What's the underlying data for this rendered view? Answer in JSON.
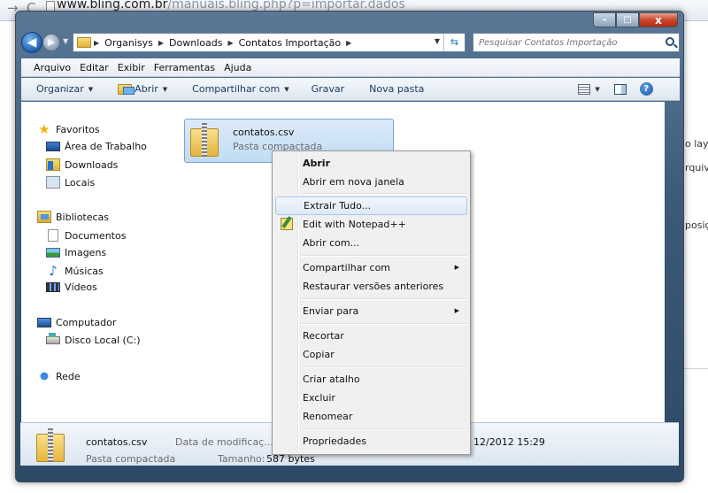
{
  "browser": {
    "url_domain": "www.bling.com.br",
    "url_path": "/manuais.bling.php?p=importar.dados"
  },
  "background_text": {
    "line1": "o lay",
    "line2": "rquivo",
    "line3": "posiç"
  },
  "window": {
    "caption_buttons": {
      "minimize": "–",
      "maximize": "□",
      "close": "x"
    }
  },
  "address_bar": {
    "breadcrumbs": [
      "Organisys",
      "Downloads",
      "Contatos Importação"
    ],
    "search_placeholder": "Pesquisar Contatos Importação"
  },
  "menubar": [
    "Arquivo",
    "Editar",
    "Exibir",
    "Ferramentas",
    "Ajuda"
  ],
  "toolbar": {
    "organize": "Organizar",
    "open": "Abrir",
    "share": "Compartilhar com",
    "burn": "Gravar",
    "new_folder": "Nova pasta",
    "help": "?"
  },
  "navpane": {
    "favorites": "Favoritos",
    "desktop": "Área de Trabalho",
    "downloads": "Downloads",
    "places": "Locais",
    "libraries": "Bibliotecas",
    "documents": "Documentos",
    "images": "Imagens",
    "music": "Músicas",
    "videos": "Vídeos",
    "computer": "Computador",
    "local_disk": "Disco Local (C:)",
    "network": "Rede"
  },
  "file": {
    "name": "contatos.csv",
    "type": "Pasta compactada"
  },
  "details": {
    "name": "contatos.csv",
    "type": "Pasta compactada",
    "modified_label": "Data de modificaç... 1",
    "modified_value": "12/2012 15:29",
    "size_label": "Tamanho:",
    "size_value": "587 bytes"
  },
  "context_menu": {
    "open": "Abrir",
    "open_new_window": "Abrir em nova janela",
    "extract_all": "Extrair Tudo...",
    "edit_notepad": "Edit with Notepad++",
    "open_with": "Abrir com...",
    "share_with": "Compartilhar com",
    "restore_versions": "Restaurar versões anteriores",
    "send_to": "Enviar para",
    "cut": "Recortar",
    "copy": "Copiar",
    "create_shortcut": "Criar atalho",
    "delete": "Excluir",
    "rename": "Renomear",
    "properties": "Propriedades"
  }
}
